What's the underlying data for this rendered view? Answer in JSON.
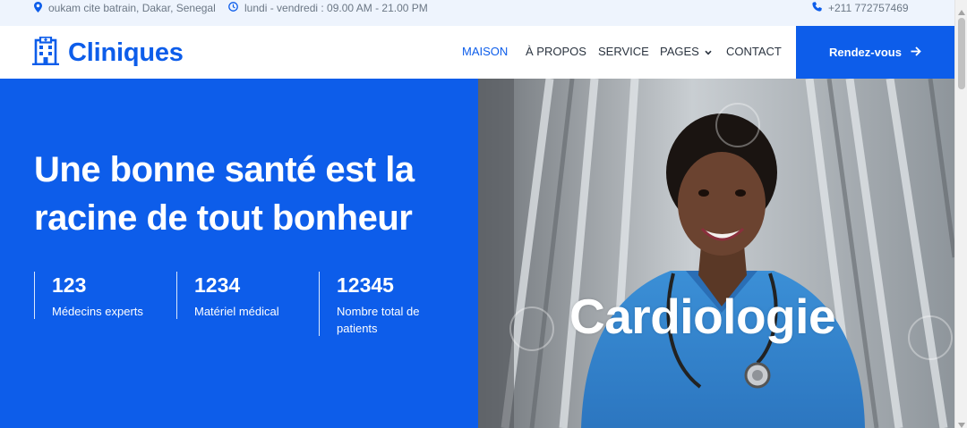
{
  "topbar": {
    "address": "oukam cite batrain, Dakar, Senegal",
    "hours": "lundi - vendredi : 09.00 AM - 21.00 PM",
    "phone": "+211 772757469",
    "icons": [
      "map-marker-icon",
      "clock-icon",
      "phone-icon"
    ]
  },
  "header": {
    "brand": "Cliniques",
    "brand_icon": "hospital-icon",
    "menu": [
      {
        "label": "MAISON",
        "active": true
      },
      {
        "label": "À PROPOS",
        "active": false
      },
      {
        "label": "SERVICE",
        "active": false
      },
      {
        "label": "PAGES",
        "active": false,
        "dropdown": true
      },
      {
        "label": "CONTACT",
        "active": false
      }
    ],
    "cta_label": "Rendez-vous",
    "cta_icon": "arrow-right-icon"
  },
  "hero": {
    "title": "Une bonne santé est la racine de tout bonheur",
    "stats": [
      {
        "value": "123",
        "label": "Médecins experts"
      },
      {
        "value": "1234",
        "label": "Matériel médical"
      },
      {
        "value": "12345",
        "label": "Nombre total de patients"
      }
    ],
    "image_caption": "Cardiologie",
    "image_alt_subject": "smiling nurse in blue scrubs with stethoscope"
  },
  "colors": {
    "primary": "#0d5dea",
    "topbar_bg": "#eef4fd",
    "text_dark": "#2b3440",
    "text_muted": "#6b7785",
    "white": "#ffffff"
  }
}
